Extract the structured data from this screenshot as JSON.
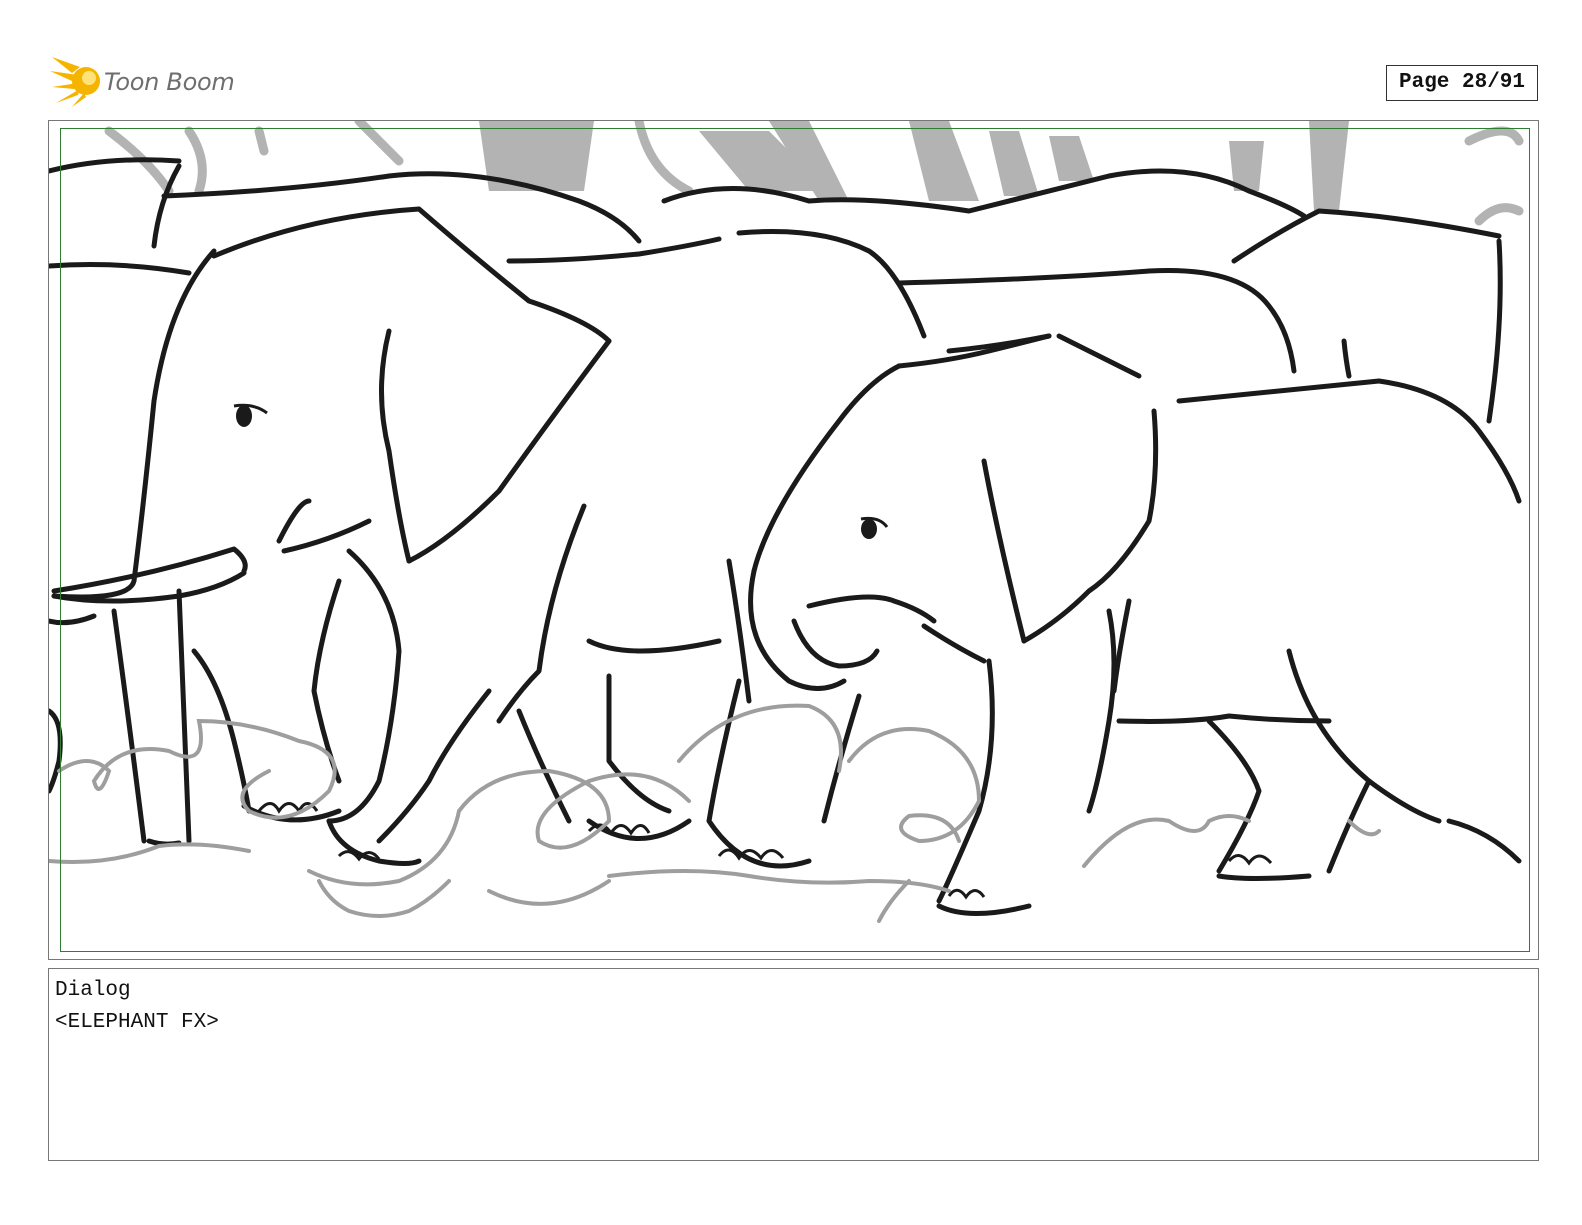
{
  "header": {
    "logo_text": "Toon Boom",
    "logo_icon": "toon-boom-burst-icon",
    "page_label": "Page 28/91"
  },
  "panel": {
    "content": "storyboard-sketch",
    "frame_color": "#2e7d32"
  },
  "dialog": {
    "label": "Dialog",
    "text": "<ELEPHANT FX>"
  },
  "colors": {
    "logo_yellow": "#f5b400",
    "logo_text": "#6d6e70",
    "sketch_line": "#1a1a1a",
    "background_sketch": "#b3b3b3"
  }
}
